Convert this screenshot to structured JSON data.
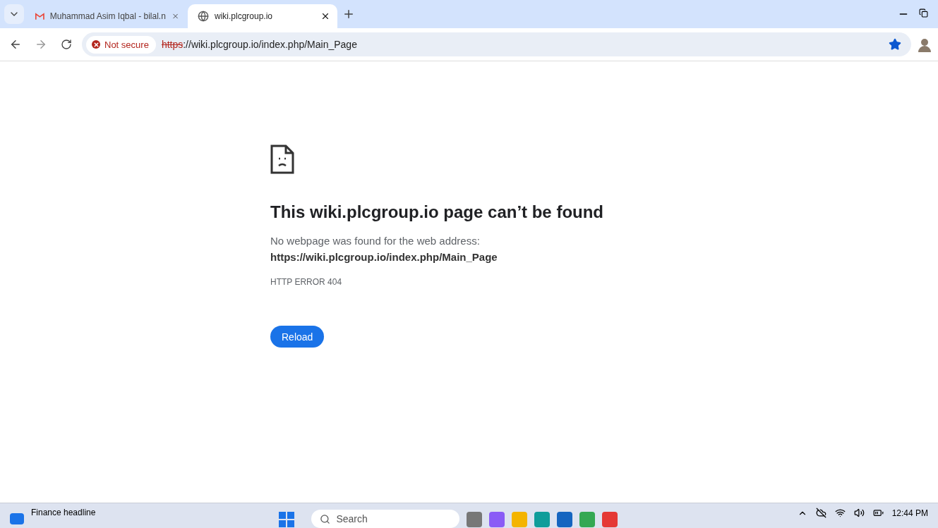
{
  "tabs": [
    {
      "title": "Muhammad Asim Iqbal - bilal.n",
      "kind": "mail",
      "selected": false
    },
    {
      "title": "wiki.plcgroup.io",
      "kind": "globe",
      "selected": true
    }
  ],
  "address_bar": {
    "security_label": "Not secure",
    "url_scheme": "https",
    "url_rest": "://wiki.plcgroup.io/index.php/Main_Page",
    "bookmarked": true
  },
  "error_page": {
    "heading": "This wiki.plcgroup.io page can’t be found",
    "message": "No webpage was found for the web address:",
    "url": "https://wiki.plcgroup.io/index.php/Main_Page",
    "code": "HTTP ERROR 404",
    "button": "Reload"
  },
  "taskbar": {
    "widget": "Finance headline",
    "search_placeholder": "Search",
    "time": "12:44 PM"
  }
}
